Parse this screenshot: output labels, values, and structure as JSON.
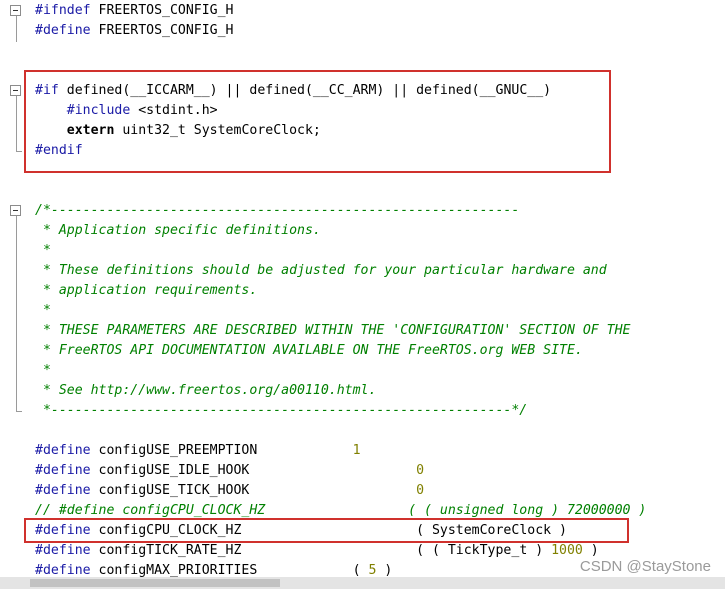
{
  "code_lines": [
    {
      "segments": [
        {
          "t": "#ifndef",
          "c": "pp"
        },
        {
          "t": " FREERTOS_CONFIG_H",
          "c": "plain"
        }
      ]
    },
    {
      "segments": [
        {
          "t": "#define",
          "c": "pp"
        },
        {
          "t": " FREERTOS_CONFIG_H",
          "c": "plain"
        }
      ]
    },
    {
      "segments": []
    },
    {
      "segments": []
    },
    {
      "segments": [
        {
          "t": "#if",
          "c": "pp"
        },
        {
          "t": " defined(__ICCARM__) || defined(__CC_ARM) || defined(__GNUC__)",
          "c": "plain"
        }
      ]
    },
    {
      "segments": [
        {
          "t": "    #include",
          "c": "pp"
        },
        {
          "t": " <stdint.h>",
          "c": "plain"
        }
      ]
    },
    {
      "segments": [
        {
          "t": "    extern",
          "c": "kw"
        },
        {
          "t": " uint32_t SystemCoreClock;",
          "c": "plain"
        }
      ]
    },
    {
      "segments": [
        {
          "t": "#endif",
          "c": "pp"
        }
      ]
    },
    {
      "segments": []
    },
    {
      "segments": []
    },
    {
      "segments": [
        {
          "t": "/*-----------------------------------------------------------",
          "c": "cm"
        }
      ]
    },
    {
      "segments": [
        {
          "t": " * Application specific definitions.",
          "c": "cm"
        }
      ]
    },
    {
      "segments": [
        {
          "t": " *",
          "c": "cm"
        }
      ]
    },
    {
      "segments": [
        {
          "t": " * These definitions should be adjusted for your particular hardware and",
          "c": "cm"
        }
      ]
    },
    {
      "segments": [
        {
          "t": " * application requirements.",
          "c": "cm"
        }
      ]
    },
    {
      "segments": [
        {
          "t": " *",
          "c": "cm"
        }
      ]
    },
    {
      "segments": [
        {
          "t": " * THESE PARAMETERS ARE DESCRIBED WITHIN THE 'CONFIGURATION' SECTION OF THE",
          "c": "cm"
        }
      ]
    },
    {
      "segments": [
        {
          "t": " * FreeRTOS API DOCUMENTATION AVAILABLE ON THE FreeRTOS.org WEB SITE.",
          "c": "cm"
        }
      ]
    },
    {
      "segments": [
        {
          "t": " *",
          "c": "cm"
        }
      ]
    },
    {
      "segments": [
        {
          "t": " * See http://www.freertos.org/a00110.html.",
          "c": "cm"
        }
      ]
    },
    {
      "segments": [
        {
          "t": " *----------------------------------------------------------*/",
          "c": "cm"
        }
      ]
    },
    {
      "segments": []
    },
    {
      "segments": [
        {
          "t": "#define",
          "c": "pp"
        },
        {
          "t": " configUSE_PREEMPTION            ",
          "c": "plain"
        },
        {
          "t": "1",
          "c": "num"
        }
      ]
    },
    {
      "segments": [
        {
          "t": "#define",
          "c": "pp"
        },
        {
          "t": " configUSE_IDLE_HOOK                     ",
          "c": "plain"
        },
        {
          "t": "0",
          "c": "num"
        }
      ]
    },
    {
      "segments": [
        {
          "t": "#define",
          "c": "pp"
        },
        {
          "t": " configUSE_TICK_HOOK                     ",
          "c": "plain"
        },
        {
          "t": "0",
          "c": "num"
        }
      ]
    },
    {
      "segments": [
        {
          "t": "// #define configCPU_CLOCK_HZ                  ( ( unsigned long ) 72000000 )",
          "c": "cm"
        }
      ]
    },
    {
      "segments": [
        {
          "t": "#define",
          "c": "pp"
        },
        {
          "t": " configCPU_CLOCK_HZ                      ( SystemCoreClock )",
          "c": "plain"
        }
      ]
    },
    {
      "segments": [
        {
          "t": "#define",
          "c": "pp"
        },
        {
          "t": " configTICK_RATE_HZ                      ( ( TickType_t ) ",
          "c": "plain"
        },
        {
          "t": "1000",
          "c": "num"
        },
        {
          "t": " )",
          "c": "plain"
        }
      ]
    },
    {
      "segments": [
        {
          "t": "#define",
          "c": "pp"
        },
        {
          "t": " configMAX_PRIORITIES            ( ",
          "c": "plain"
        },
        {
          "t": "5",
          "c": "num"
        },
        {
          "t": " )",
          "c": "plain"
        }
      ]
    }
  ],
  "watermark": "CSDN @StayStone",
  "colors": {
    "preprocessor": "#1a1aa6",
    "comment": "#008000",
    "number": "#808000",
    "highlight": "#d0312d"
  }
}
